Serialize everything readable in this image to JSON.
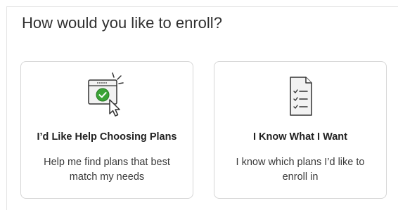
{
  "enrollment": {
    "title": "How would you like to enroll?",
    "options": [
      {
        "icon": "cursor-click-check-icon",
        "title": "I’d Like Help Choosing Plans",
        "description": "Help me find plans that best match my needs"
      },
      {
        "icon": "checklist-document-icon",
        "title": "I Know What I Want",
        "description": "I know which plans I’d like to enroll in"
      }
    ]
  },
  "colors": {
    "accent_green": "#3aa335",
    "icon_stroke": "#333333",
    "border": "#d6d6d6"
  }
}
